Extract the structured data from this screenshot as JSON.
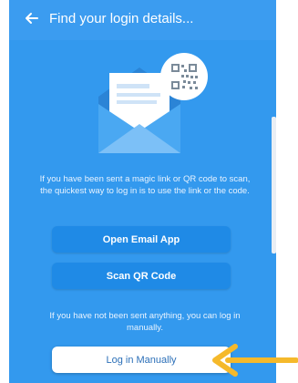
{
  "header": {
    "title": "Find your login details...",
    "back_icon": "arrow-left-icon"
  },
  "illustration": {
    "envelope_icon": "envelope-icon",
    "qr_icon": "qr-code-icon"
  },
  "intro_text": "If you have been sent a magic link or QR code to scan, the quickest way to log in is to use the link or the code.",
  "buttons": {
    "open_email": "Open Email App",
    "scan_qr": "Scan QR Code",
    "log_in_manually": "Log in Manually"
  },
  "fallback_text": "If you have not been sent anything, you can log in manually.",
  "colors": {
    "background": "#3399ee",
    "button_primary": "#1f8ae6",
    "button_secondary": "#ffffff",
    "annotation_arrow": "#f5b92b"
  }
}
